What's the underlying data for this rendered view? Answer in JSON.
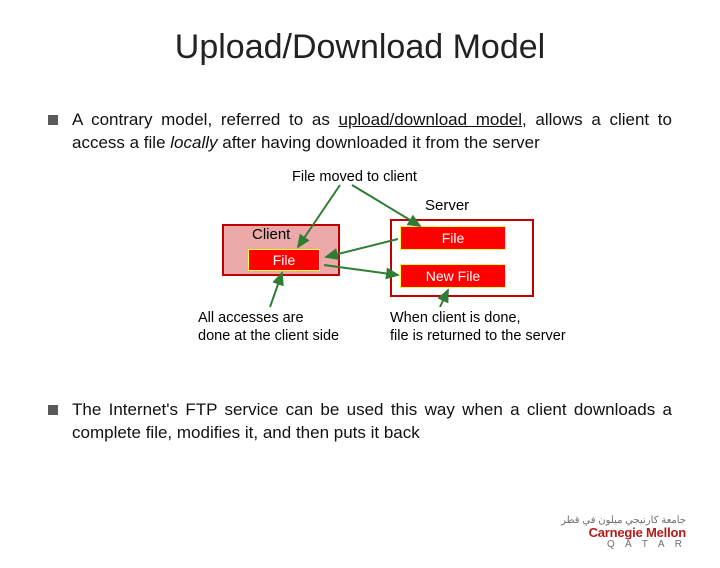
{
  "title": "Upload/Download Model",
  "bullet1_pre": "A contrary model, referred to as ",
  "bullet1_u": "upload/download model",
  "bullet1_mid": ", allows a client to access a file ",
  "bullet1_it": "locally",
  "bullet1_post": " after having downloaded it from the server",
  "diagram": {
    "caption_top": "File moved to client",
    "server_label": "Server",
    "client_label": "Client",
    "server_file": "File",
    "server_newfile": "New File",
    "client_file": "File",
    "caption_left_l1": "All accesses are",
    "caption_left_l2": "done at the client side",
    "caption_right_l1": "When client is done,",
    "caption_right_l2": "file is returned to the server"
  },
  "bullet2": "The Internet's FTP service can be used this way when a client downloads a complete file, modifies it, and then puts it back",
  "logo": {
    "arabic": "جامعة كارنيجي ميلون في قطر",
    "line1": "Carnegie Mellon",
    "line2": "Q A T A R"
  }
}
